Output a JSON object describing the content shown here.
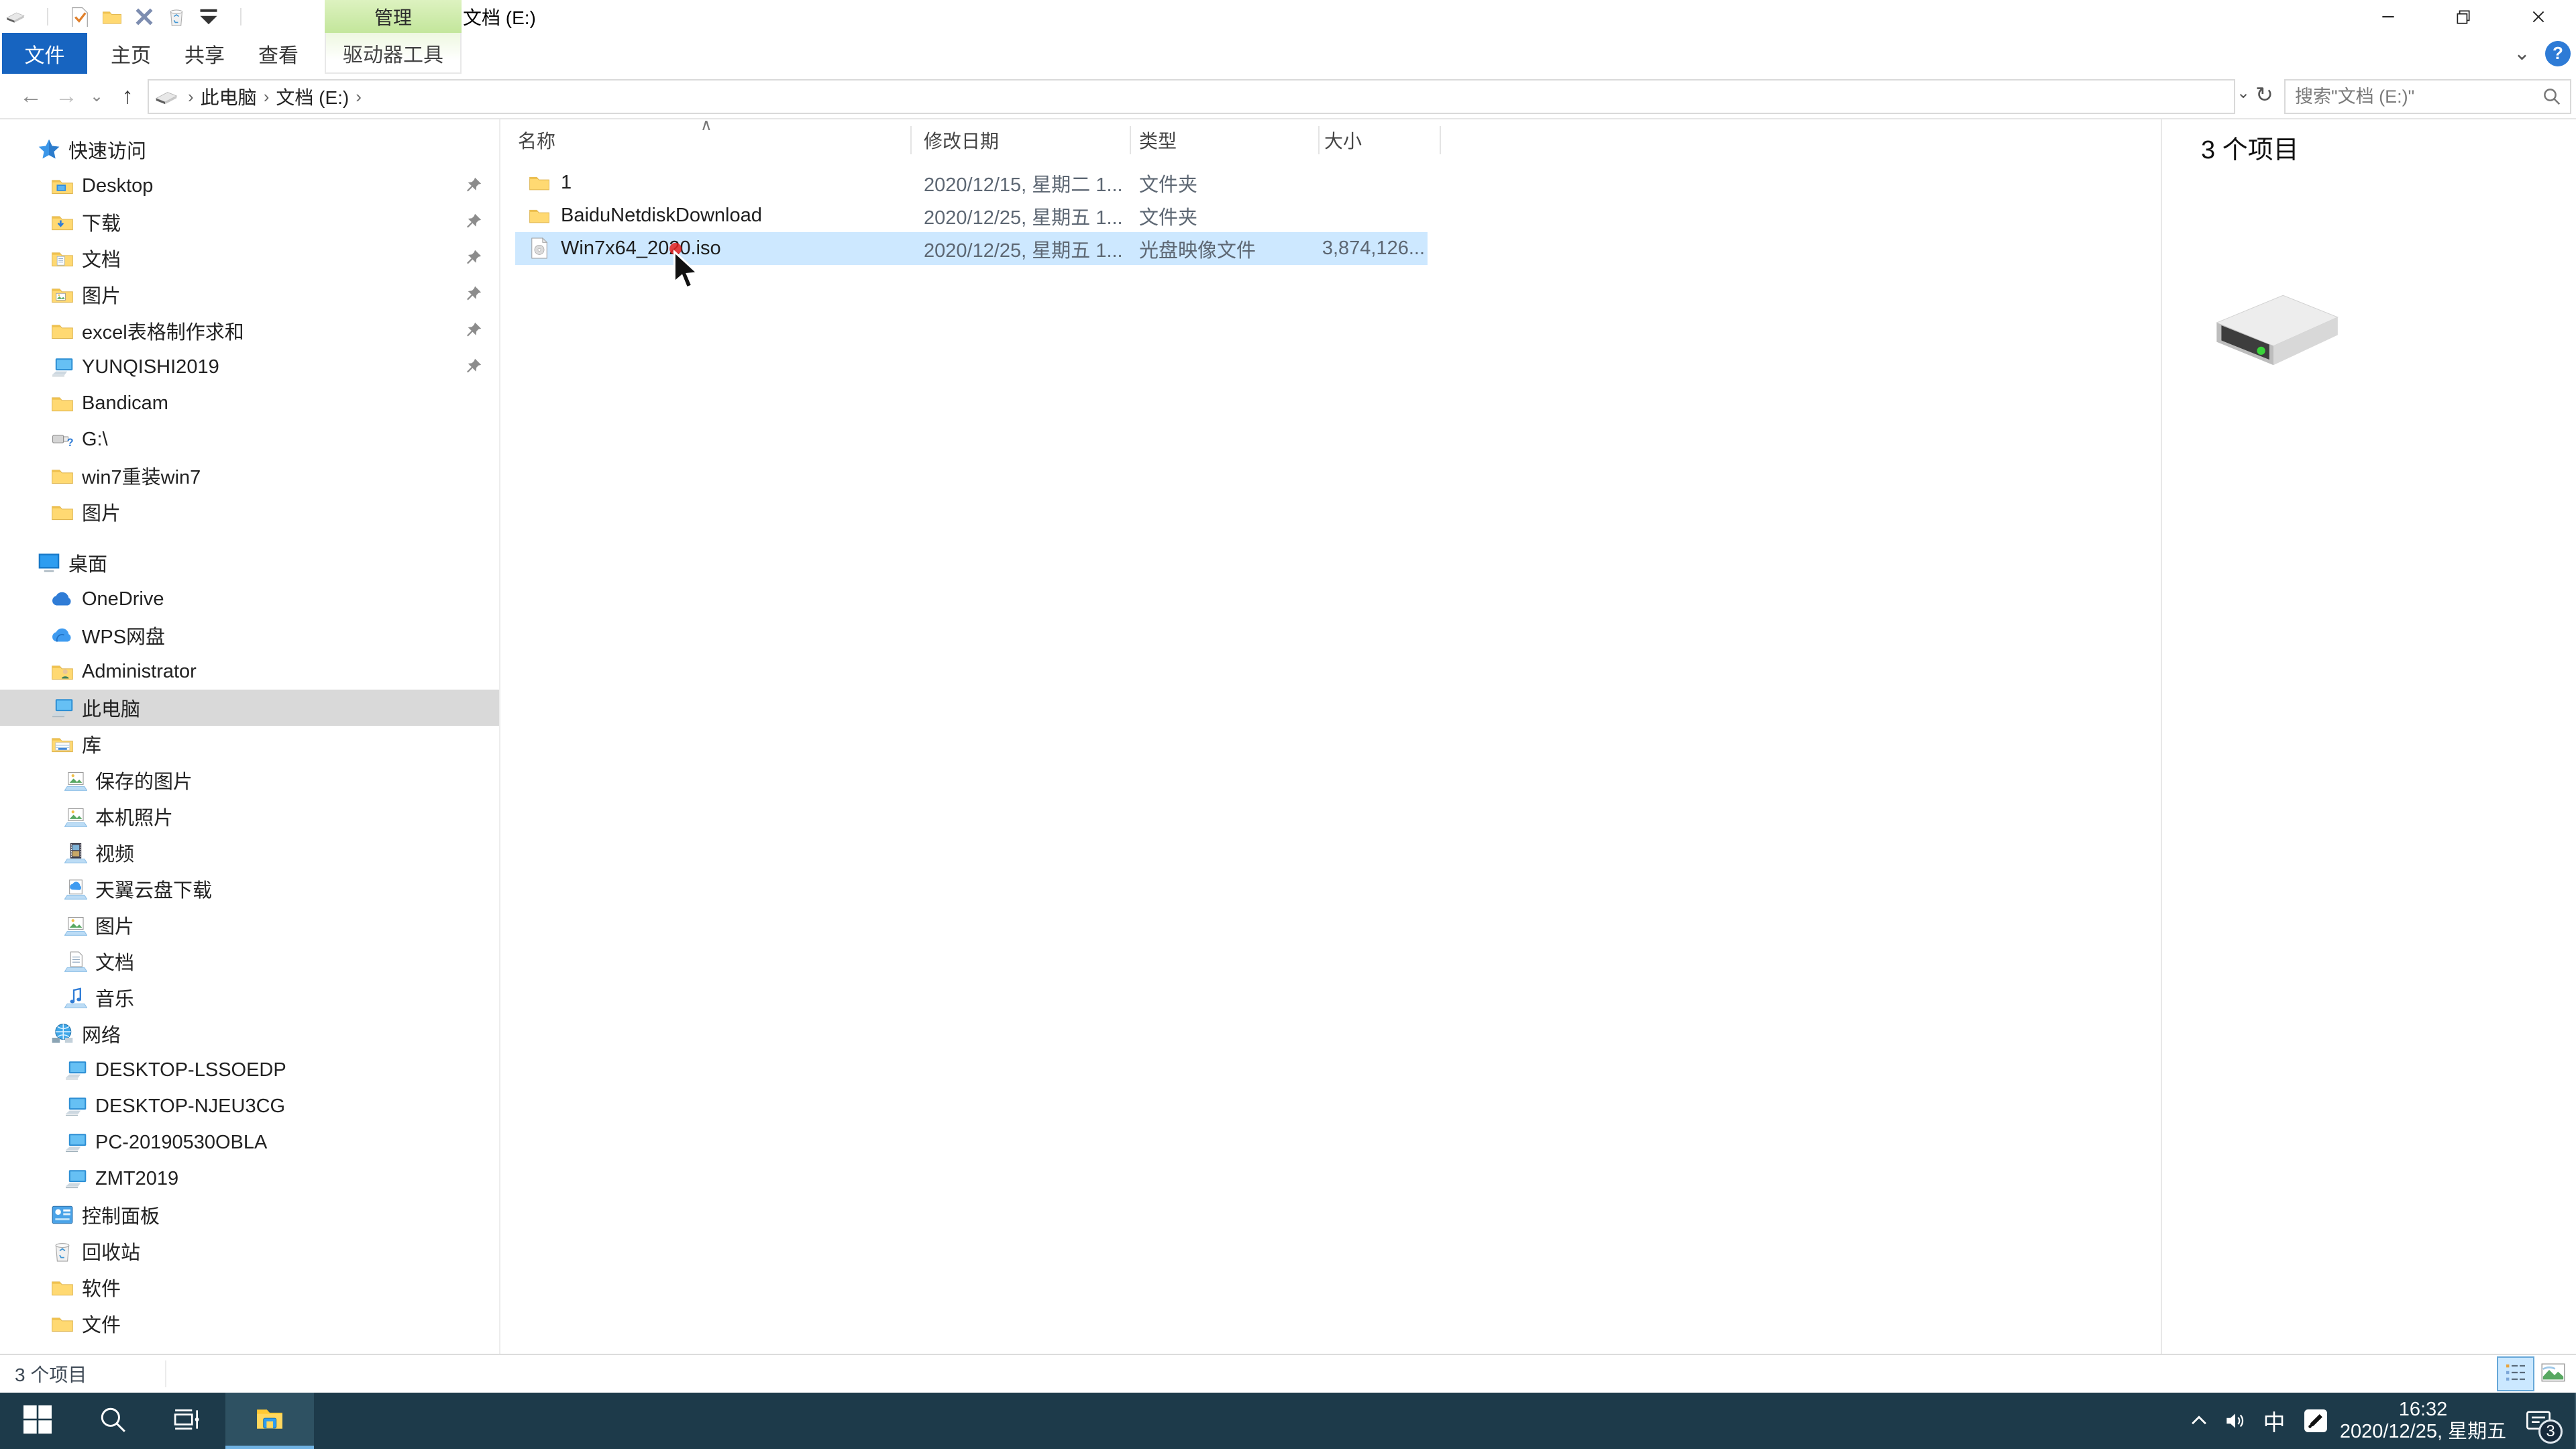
{
  "window": {
    "title": "文档 (E:)",
    "ctx_header": "管理",
    "qat_icons": [
      {
        "icon": "drive"
      },
      {
        "icon": "sep"
      },
      {
        "icon": "check-doc"
      },
      {
        "icon": "folder-plain"
      },
      {
        "icon": "xmark"
      },
      {
        "icon": "recycle"
      },
      {
        "icon": "dropdown"
      },
      {
        "icon": "sep"
      }
    ]
  },
  "ribbon": {
    "file_tab": "文件",
    "tabs": [
      "主页",
      "共享",
      "查看"
    ],
    "ctx_tab": "驱动器工具",
    "help_label": "?"
  },
  "address": {
    "crumbs": [
      "此电脑",
      "文档 (E:)"
    ],
    "search_placeholder": "搜索\"文档 (E:)\""
  },
  "sidebar": {
    "items": [
      {
        "label": "快速访问",
        "icon": "star",
        "depth": 0
      },
      {
        "label": "Desktop",
        "icon": "folder-desktop",
        "depth": 1,
        "pinned": true
      },
      {
        "label": "下载",
        "icon": "folder-download",
        "depth": 1,
        "pinned": true
      },
      {
        "label": "文档",
        "icon": "folder-docs",
        "depth": 1,
        "pinned": true
      },
      {
        "label": "图片",
        "icon": "folder-pics",
        "depth": 1,
        "pinned": true
      },
      {
        "label": "excel表格制作求和",
        "icon": "folder-plain",
        "depth": 1,
        "pinned": true
      },
      {
        "label": "YUNQISHI2019",
        "icon": "monitor",
        "depth": 1,
        "pinned": true
      },
      {
        "label": "Bandicam",
        "icon": "folder-plain",
        "depth": 1
      },
      {
        "label": "G:\\",
        "icon": "usb",
        "depth": 1
      },
      {
        "label": "win7重装win7",
        "icon": "folder-plain",
        "depth": 1
      },
      {
        "label": "图片",
        "icon": "folder-plain",
        "depth": 1
      },
      {
        "label": "桌面",
        "icon": "desktop",
        "depth": 0,
        "gap": true
      },
      {
        "label": "OneDrive",
        "icon": "cloud",
        "depth": 1
      },
      {
        "label": "WPS网盘",
        "icon": "cloud-wps",
        "depth": 1
      },
      {
        "label": "Administrator",
        "icon": "folder-user",
        "depth": 1
      },
      {
        "label": "此电脑",
        "icon": "monitor",
        "depth": 1,
        "selected": true
      },
      {
        "label": "库",
        "icon": "library",
        "depth": 1
      },
      {
        "label": "保存的图片",
        "icon": "lib-pics",
        "depth": 2
      },
      {
        "label": "本机照片",
        "icon": "lib-pics",
        "depth": 2
      },
      {
        "label": "视频",
        "icon": "lib-video",
        "depth": 2
      },
      {
        "label": "天翼云盘下载",
        "icon": "lib-clouddl",
        "depth": 2
      },
      {
        "label": "图片",
        "icon": "lib-pics",
        "depth": 2
      },
      {
        "label": "文档",
        "icon": "lib-doc",
        "depth": 2
      },
      {
        "label": "音乐",
        "icon": "lib-music",
        "depth": 2
      },
      {
        "label": "网络",
        "icon": "network",
        "depth": 1
      },
      {
        "label": "DESKTOP-LSSOEDP",
        "icon": "monitor",
        "depth": 2
      },
      {
        "label": "DESKTOP-NJEU3CG",
        "icon": "monitor",
        "depth": 2
      },
      {
        "label": "PC-20190530OBLA",
        "icon": "monitor",
        "depth": 2
      },
      {
        "label": "ZMT2019",
        "icon": "monitor",
        "depth": 2
      },
      {
        "label": "控制面板",
        "icon": "control-panel",
        "depth": 1
      },
      {
        "label": "回收站",
        "icon": "recycle",
        "depth": 1
      },
      {
        "label": "软件",
        "icon": "folder-plain",
        "depth": 1
      },
      {
        "label": "文件",
        "icon": "folder-plain",
        "depth": 1
      }
    ]
  },
  "files": {
    "columns": [
      "名称",
      "修改日期",
      "类型",
      "大小"
    ],
    "sort_indicator": "∧",
    "rows": [
      {
        "name": "1",
        "icon": "folder-plain",
        "date": "2020/12/15, 星期二 1...",
        "type": "文件夹",
        "size": ""
      },
      {
        "name": "BaiduNetdiskDownload",
        "icon": "folder-plain",
        "date": "2020/12/25, 星期五 1...",
        "type": "文件夹",
        "size": ""
      },
      {
        "name": "Win7x64_2020.iso",
        "icon": "iso",
        "date": "2020/12/25, 星期五 1...",
        "type": "光盘映像文件",
        "size": "3,874,126...",
        "selected": true
      }
    ]
  },
  "details": {
    "count": "3 个项目"
  },
  "status": {
    "count": "3 个项目",
    "view_buttons": [
      {
        "icon": "view-details",
        "active": true
      },
      {
        "icon": "view-thumbs"
      }
    ]
  },
  "taskbar": {
    "buttons": [
      {
        "icon": "start"
      },
      {
        "icon": "search"
      },
      {
        "icon": "taskview"
      },
      {
        "icon": "explorer",
        "active": true
      }
    ],
    "tray_icon_names": [
      "chevron-up",
      "volume",
      "ime",
      "pen-app",
      "action-center"
    ],
    "ime": "中",
    "time": "16:32",
    "date": "2020/12/25, 星期五",
    "badge": "3"
  }
}
